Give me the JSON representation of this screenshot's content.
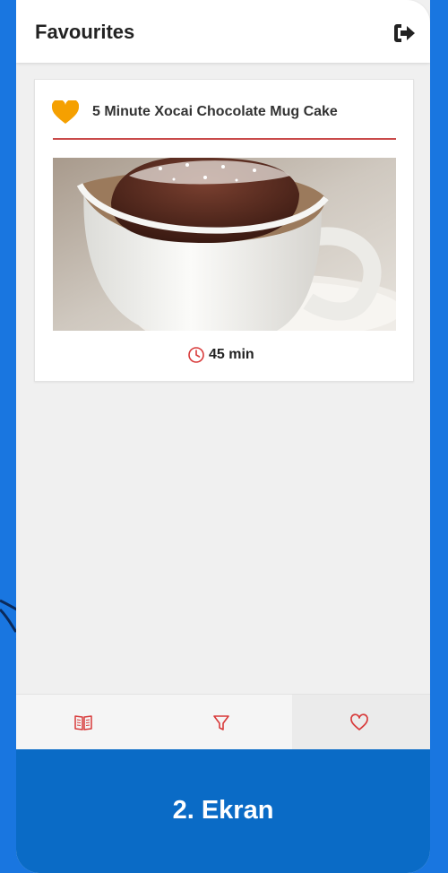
{
  "appbar": {
    "title": "Favourites",
    "logout_icon": "logout-icon"
  },
  "recipe": {
    "title": "5 Minute Xocai Chocolate Mug Cake",
    "favorite_icon": "heart-filled-icon",
    "image": "chocolate-mug-cake-photo",
    "time_icon": "clock-icon",
    "time": "45 min"
  },
  "nav": {
    "items": [
      {
        "icon": "book-icon",
        "active": false
      },
      {
        "icon": "filter-icon",
        "active": false
      },
      {
        "icon": "heart-outline-icon",
        "active": true
      }
    ]
  },
  "banner": {
    "label": "2. Ekran"
  },
  "colors": {
    "background": "#1976e0",
    "banner": "#0a6bc6",
    "accent_red": "#c94a4a",
    "heart_orange": "#f5a000"
  }
}
